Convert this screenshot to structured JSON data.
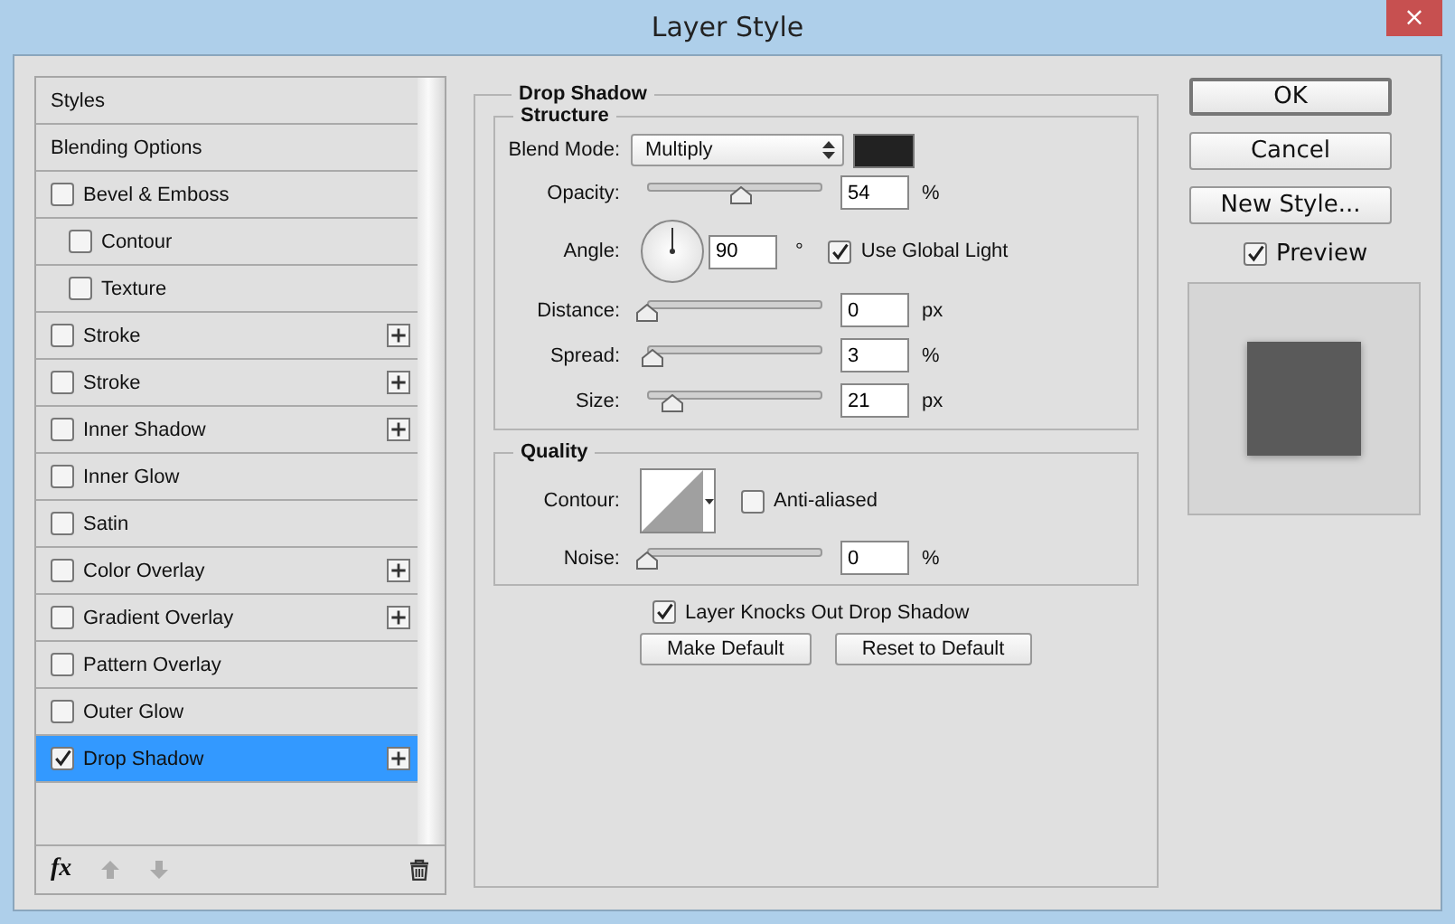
{
  "window": {
    "title": "Layer Style",
    "close": "×"
  },
  "styles_list": [
    {
      "kind": "header",
      "label": "Styles",
      "selected": false
    },
    {
      "kind": "header",
      "label": "Blending Options",
      "selected": false
    },
    {
      "kind": "effect",
      "label": "Bevel & Emboss",
      "checked": false,
      "selected": false,
      "addable": false,
      "children": [
        {
          "kind": "effect",
          "label": "Contour",
          "checked": false,
          "selected": false,
          "addable": false
        },
        {
          "kind": "effect",
          "label": "Texture",
          "checked": false,
          "selected": false,
          "addable": false
        }
      ]
    },
    {
      "kind": "effect",
      "label": "Stroke",
      "checked": false,
      "selected": false,
      "addable": true
    },
    {
      "kind": "effect",
      "label": "Stroke",
      "checked": false,
      "selected": false,
      "addable": true
    },
    {
      "kind": "effect",
      "label": "Inner Shadow",
      "checked": false,
      "selected": false,
      "addable": true
    },
    {
      "kind": "effect",
      "label": "Inner Glow",
      "checked": false,
      "selected": false,
      "addable": false
    },
    {
      "kind": "effect",
      "label": "Satin",
      "checked": false,
      "selected": false,
      "addable": false
    },
    {
      "kind": "effect",
      "label": "Color Overlay",
      "checked": false,
      "selected": false,
      "addable": true
    },
    {
      "kind": "effect",
      "label": "Gradient Overlay",
      "checked": false,
      "selected": false,
      "addable": true
    },
    {
      "kind": "effect",
      "label": "Pattern Overlay",
      "checked": false,
      "selected": false,
      "addable": false
    },
    {
      "kind": "effect",
      "label": "Outer Glow",
      "checked": false,
      "selected": false,
      "addable": false
    },
    {
      "kind": "effect",
      "label": "Drop Shadow",
      "checked": true,
      "selected": true,
      "addable": true
    }
  ],
  "list_footer": {
    "fx": "fx"
  },
  "drop_shadow": {
    "title": "Drop Shadow",
    "structure": {
      "title": "Structure",
      "controls": [
        {
          "kind": "blend",
          "label": "Blend Mode:",
          "value": "Multiply",
          "color": "#222222"
        },
        {
          "kind": "slider",
          "label": "Opacity:",
          "level": 0.54,
          "value": "54",
          "unit": "%"
        },
        {
          "kind": "angle",
          "label": "Angle:",
          "value": "90",
          "unit": "°",
          "global_light": {
            "label": "Use Global Light",
            "checked": true
          }
        },
        {
          "kind": "slider",
          "label": "Distance:",
          "level": 0,
          "value": "0",
          "unit": "px"
        },
        {
          "kind": "slider",
          "label": "Spread:",
          "level": 0.03,
          "value": "3",
          "unit": "%"
        },
        {
          "kind": "slider",
          "label": "Size:",
          "level": 0.14,
          "value": "21",
          "unit": "px"
        }
      ]
    },
    "quality": {
      "title": "Quality",
      "contour": {
        "label": "Contour:",
        "anti_aliased": {
          "label": "Anti-aliased",
          "checked": false
        }
      },
      "noise": {
        "label": "Noise:",
        "level": 0,
        "value": "0",
        "unit": "%"
      }
    },
    "knockout": {
      "label": "Layer Knocks Out Drop Shadow",
      "checked": true
    },
    "buttons": [
      "Make Default",
      "Reset to Default"
    ]
  },
  "side_buttons": [
    "OK",
    "Cancel",
    "New Style..."
  ],
  "preview": {
    "label": "Preview",
    "checked": true
  }
}
